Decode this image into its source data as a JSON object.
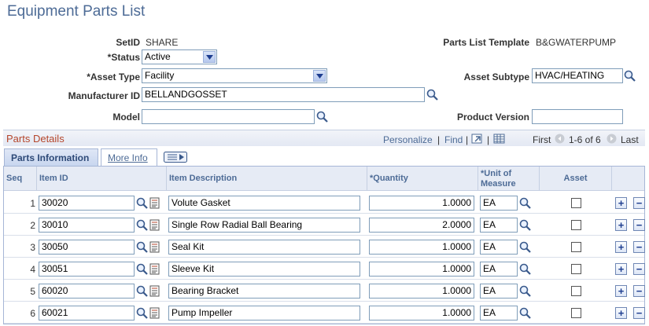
{
  "page": {
    "title": "Equipment Parts List"
  },
  "header": {
    "setid_label": "SetID",
    "setid_value": "SHARE",
    "template_label": "Parts List Template",
    "template_value": "B&GWATERPUMP",
    "status_label": "*Status",
    "status_value": "Active",
    "asset_type_label": "*Asset Type",
    "asset_type_value": "Facility",
    "asset_subtype_label": "Asset Subtype",
    "asset_subtype_value": "HVAC/HEATING",
    "manufacturer_label": "Manufacturer ID",
    "manufacturer_value": "BELLANDGOSSET",
    "model_label": "Model",
    "model_value": "",
    "product_version_label": "Product Version",
    "product_version_value": ""
  },
  "parts": {
    "section_title": "Parts Details",
    "personalize": "Personalize",
    "find": "Find",
    "sep": "|",
    "first": "First",
    "range": "1-6 of 6",
    "last": "Last",
    "tabs": [
      {
        "label": "Parts Information"
      },
      {
        "label": "More Info"
      }
    ],
    "columns": {
      "seq": "Seq",
      "item_id": "Item ID",
      "item_desc": "Item Description",
      "quantity": "*Quantity",
      "uom_1": "*Unit of",
      "uom_2": "Measure",
      "asset": "Asset"
    },
    "rows": [
      {
        "seq": "1",
        "item_id": "30020",
        "desc": "Volute Gasket",
        "qty": "1.0000",
        "uom": "EA"
      },
      {
        "seq": "2",
        "item_id": "30010",
        "desc": "Single Row Radial Ball Bearing",
        "qty": "2.0000",
        "uom": "EA"
      },
      {
        "seq": "3",
        "item_id": "30050",
        "desc": "Seal Kit",
        "qty": "1.0000",
        "uom": "EA"
      },
      {
        "seq": "4",
        "item_id": "30051",
        "desc": "Sleeve Kit",
        "qty": "1.0000",
        "uom": "EA"
      },
      {
        "seq": "5",
        "item_id": "60020",
        "desc": "Bearing Bracket",
        "qty": "1.0000",
        "uom": "EA"
      },
      {
        "seq": "6",
        "item_id": "60021",
        "desc": "Pump Impeller",
        "qty": "1.0000",
        "uom": "EA"
      }
    ],
    "add_glyph": "+",
    "remove_glyph": "−"
  },
  "colors": {
    "title": "#4d6b96",
    "section_title": "#b5462c",
    "link": "#4d6b96",
    "border": "#7f9db9"
  },
  "icons": [
    "lookup-icon",
    "item-detail-icon",
    "dropdown-arrow-icon",
    "zoom-icon",
    "download-icon",
    "first-arrow-icon",
    "next-arrow-icon"
  ]
}
